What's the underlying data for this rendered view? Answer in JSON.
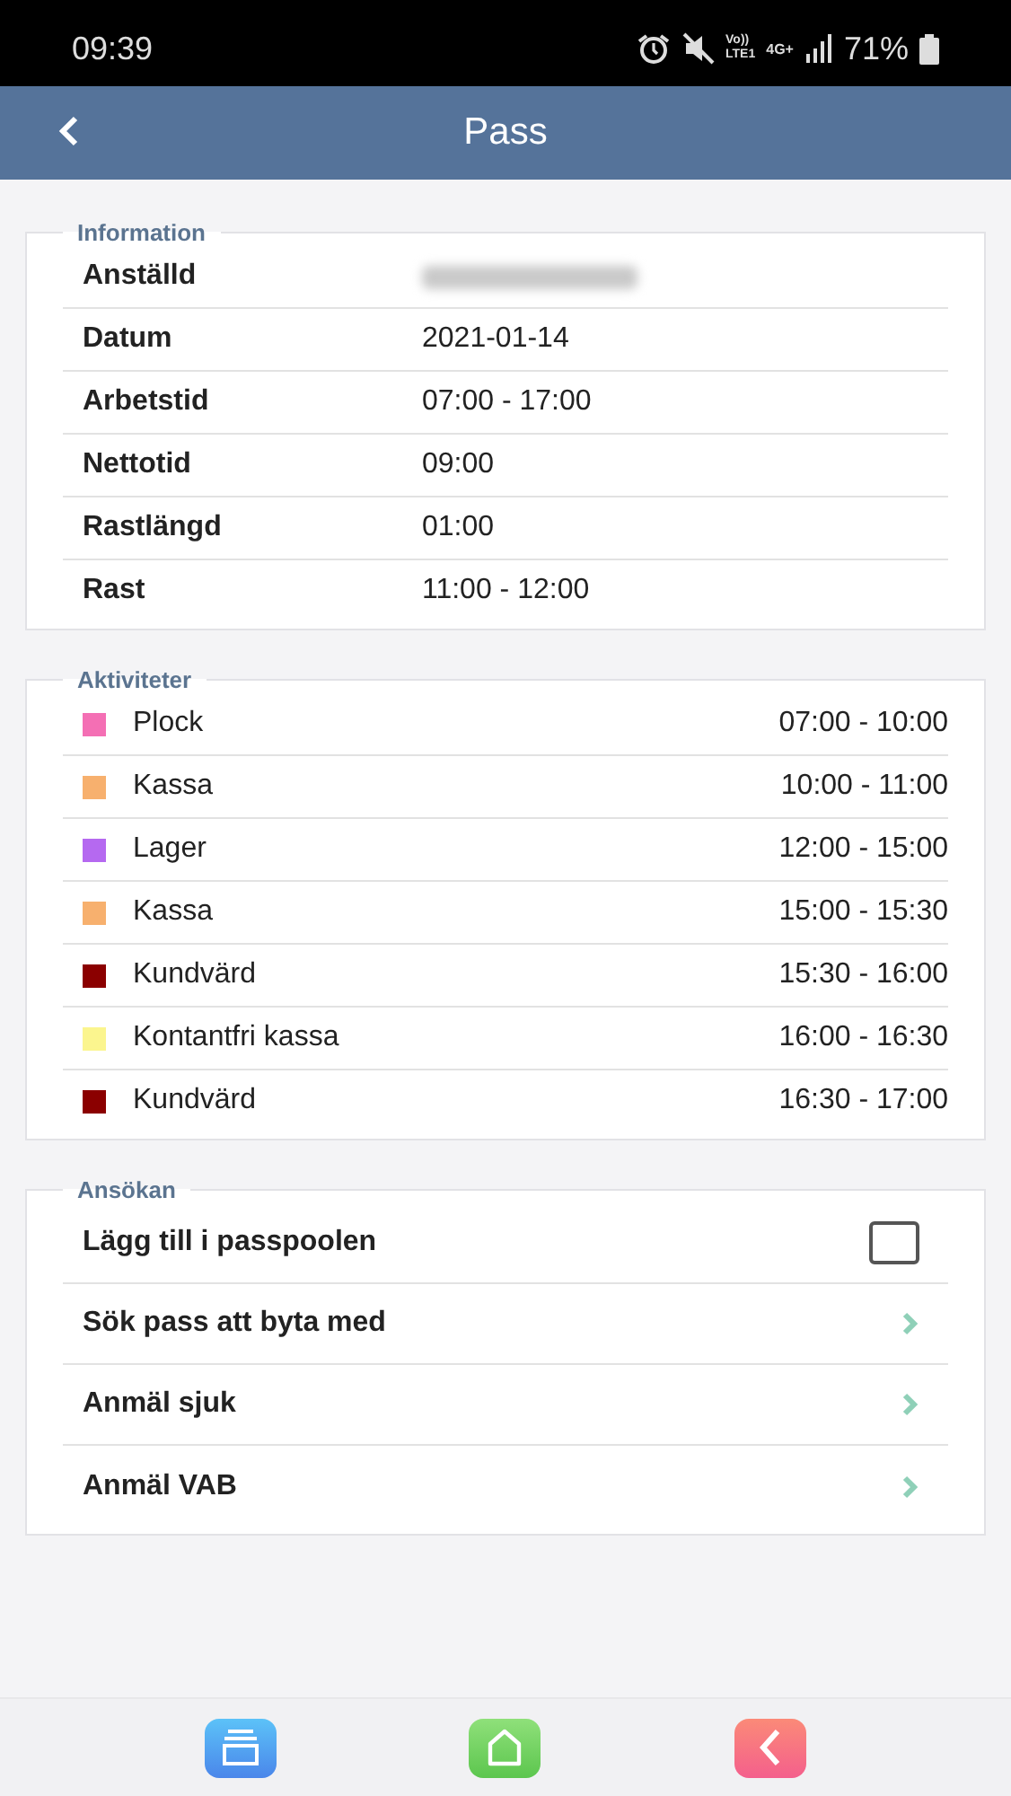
{
  "status_bar": {
    "time": "09:39",
    "volte": "Vo))",
    "lte": "LTE1",
    "network": "4G+",
    "battery": "71%"
  },
  "header": {
    "title": "Pass"
  },
  "information": {
    "title": "Information",
    "rows": [
      {
        "label": "Anställd",
        "value_blurred": true
      },
      {
        "label": "Datum",
        "value": "2021-01-14"
      },
      {
        "label": "Arbetstid",
        "value": "07:00 - 17:00"
      },
      {
        "label": "Nettotid",
        "value": "09:00"
      },
      {
        "label": "Rastlängd",
        "value": "01:00"
      },
      {
        "label": "Rast",
        "value": "11:00 - 12:00"
      }
    ]
  },
  "activities": {
    "title": "Aktiviteter",
    "items": [
      {
        "name": "Plock",
        "time": "07:00 - 10:00",
        "color": "#f46fb4"
      },
      {
        "name": "Kassa",
        "time": "10:00 - 11:00",
        "color": "#f7b06e"
      },
      {
        "name": "Lager",
        "time": "12:00 - 15:00",
        "color": "#b569f0"
      },
      {
        "name": "Kassa",
        "time": "15:00 - 15:30",
        "color": "#f7b06e"
      },
      {
        "name": "Kundvärd",
        "time": "15:30 - 16:00",
        "color": "#8b0000"
      },
      {
        "name": "Kontantfri kassa",
        "time": "16:00 - 16:30",
        "color": "#fbf58e"
      },
      {
        "name": "Kundvärd",
        "time": "16:30 - 17:00",
        "color": "#8b0000"
      }
    ]
  },
  "application": {
    "title": "Ansökan",
    "items": [
      {
        "kind": "checkbox",
        "label": "Lägg till i passpoolen",
        "checked": false
      },
      {
        "kind": "link",
        "label": "Sök pass att byta med"
      },
      {
        "kind": "link",
        "label": "Anmäl sjuk"
      },
      {
        "kind": "link",
        "label": "Anmäl VAB"
      }
    ]
  },
  "bottom_nav": [
    {
      "kind": "cards"
    },
    {
      "kind": "home"
    },
    {
      "kind": "back"
    }
  ]
}
